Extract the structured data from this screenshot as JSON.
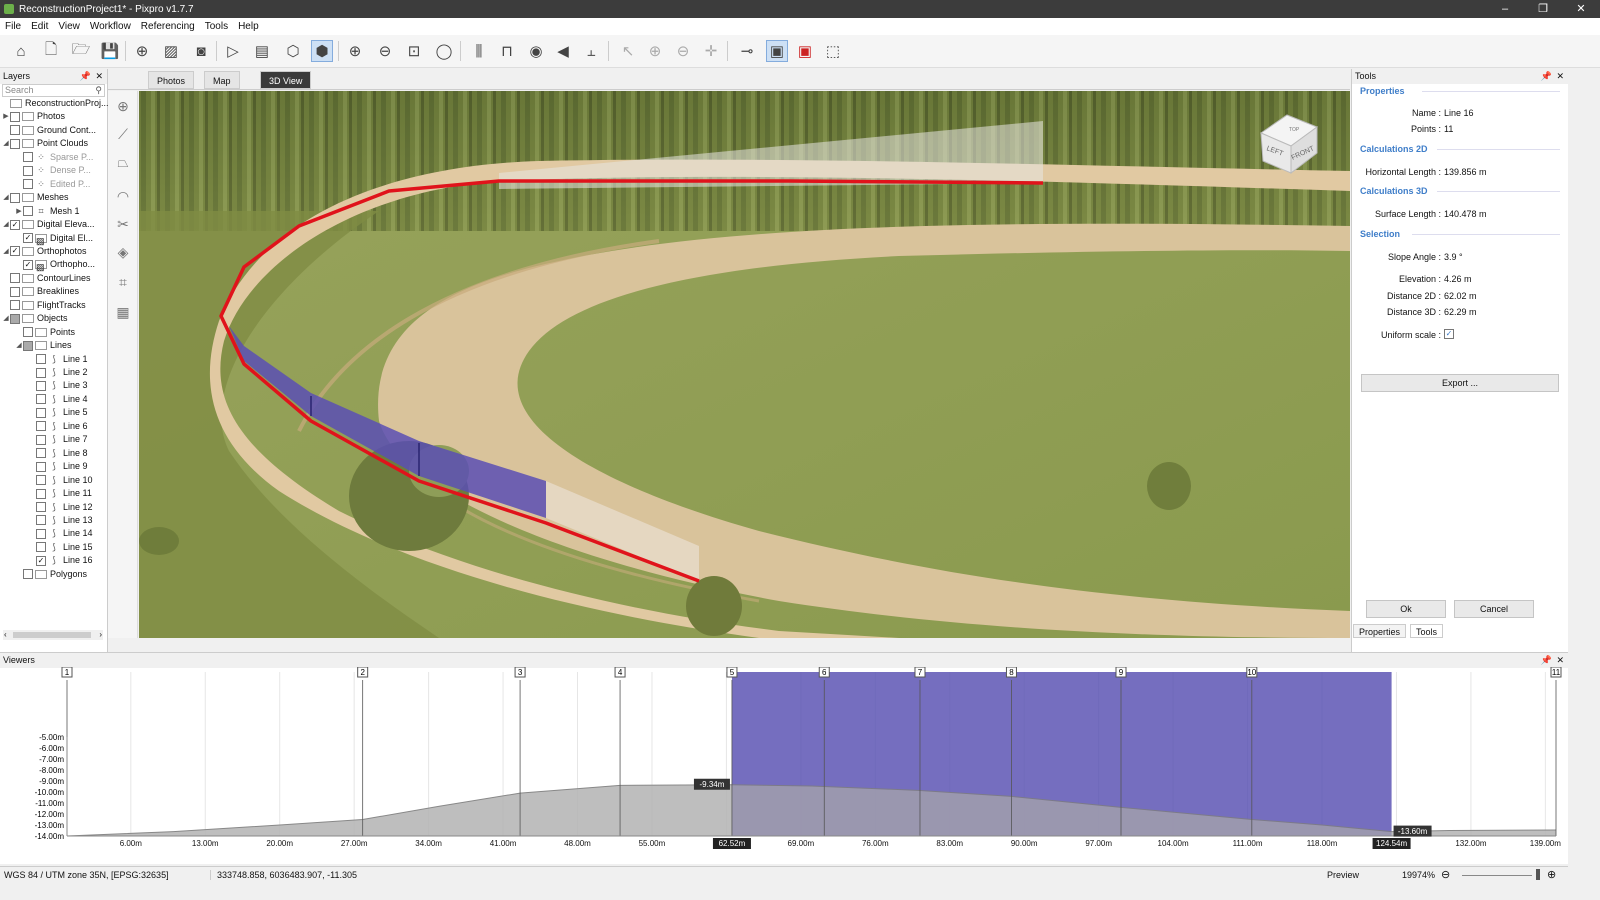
{
  "window": {
    "title": "ReconstructionProject1* - Pixpro v1.7.7",
    "controls": [
      "–",
      "❐",
      "✕"
    ]
  },
  "menu": [
    "File",
    "Edit",
    "View",
    "Workflow",
    "Referencing",
    "Tools",
    "Help"
  ],
  "toolbar": {
    "icons": [
      "home-icon",
      "new-file-icon",
      "open-folder-icon",
      "save-icon",
      "target-icon",
      "image-icon",
      "camera-icon",
      "play-icon",
      "batch-icon",
      "cube-wire-icon",
      "cube-solid-icon",
      "zoom-in-icon",
      "zoom-out-icon",
      "zoom-fit-icon",
      "zoom-window-icon",
      "align-icon",
      "measure-icon",
      "eye-icon",
      "plane-icon",
      "split-icon",
      "pointer-add-icon",
      "point-add-icon",
      "point-remove-icon",
      "point-move-icon",
      "line-point-icon",
      "view-box-icon",
      "view-box-red-icon",
      "select-rect-icon"
    ]
  },
  "layers": {
    "title": "Layers",
    "search_placeholder": "Search",
    "items": [
      {
        "label": "ReconstructionProj...",
        "level": 0,
        "twisty": "",
        "check": "none",
        "icon": "folder"
      },
      {
        "label": "Photos",
        "level": 0,
        "twisty": "▶",
        "check": "off",
        "icon": "folder"
      },
      {
        "label": "Ground Cont...",
        "level": 0,
        "twisty": "",
        "check": "off",
        "icon": "folder"
      },
      {
        "label": "Point Clouds",
        "level": 0,
        "twisty": "◢",
        "check": "off",
        "icon": "folder"
      },
      {
        "label": "Sparse P...",
        "level": 1,
        "twisty": "",
        "check": "off",
        "icon": "dots",
        "dim": true
      },
      {
        "label": "Dense P...",
        "level": 1,
        "twisty": "",
        "check": "off",
        "icon": "dots",
        "dim": true
      },
      {
        "label": "Edited P...",
        "level": 1,
        "twisty": "",
        "check": "off",
        "icon": "dots",
        "dim": true
      },
      {
        "label": "Meshes",
        "level": 0,
        "twisty": "◢",
        "check": "off",
        "icon": "folder"
      },
      {
        "label": "Mesh 1",
        "level": 1,
        "twisty": "▶",
        "check": "off",
        "icon": "mesh"
      },
      {
        "label": "Digital Eleva...",
        "level": 0,
        "twisty": "◢",
        "check": "on",
        "icon": "folder"
      },
      {
        "label": "Digital El...",
        "level": 1,
        "twisty": "",
        "check": "on",
        "icon": "image"
      },
      {
        "label": "Orthophotos",
        "level": 0,
        "twisty": "◢",
        "check": "on",
        "icon": "folder"
      },
      {
        "label": "Orthopho...",
        "level": 1,
        "twisty": "",
        "check": "on",
        "icon": "image"
      },
      {
        "label": "ContourLines",
        "level": 0,
        "twisty": "",
        "check": "off",
        "icon": "folder"
      },
      {
        "label": "Breaklines",
        "level": 0,
        "twisty": "",
        "check": "off",
        "icon": "folder"
      },
      {
        "label": "FlightTracks",
        "level": 0,
        "twisty": "",
        "check": "off",
        "icon": "folder"
      },
      {
        "label": "Objects",
        "level": 0,
        "twisty": "◢",
        "check": "partial",
        "icon": "folder"
      },
      {
        "label": "Points",
        "level": 1,
        "twisty": "",
        "check": "off",
        "icon": "folder"
      },
      {
        "label": "Lines",
        "level": 1,
        "twisty": "◢",
        "check": "partial",
        "icon": "folder"
      },
      {
        "label": "Line 1",
        "level": 2,
        "twisty": "",
        "check": "off",
        "icon": "line"
      },
      {
        "label": "Line 2",
        "level": 2,
        "twisty": "",
        "check": "off",
        "icon": "line"
      },
      {
        "label": "Line 3",
        "level": 2,
        "twisty": "",
        "check": "off",
        "icon": "line"
      },
      {
        "label": "Line 4",
        "level": 2,
        "twisty": "",
        "check": "off",
        "icon": "line"
      },
      {
        "label": "Line 5",
        "level": 2,
        "twisty": "",
        "check": "off",
        "icon": "line"
      },
      {
        "label": "Line 6",
        "level": 2,
        "twisty": "",
        "check": "off",
        "icon": "line"
      },
      {
        "label": "Line 7",
        "level": 2,
        "twisty": "",
        "check": "off",
        "icon": "line"
      },
      {
        "label": "Line 8",
        "level": 2,
        "twisty": "",
        "check": "off",
        "icon": "line"
      },
      {
        "label": "Line 9",
        "level": 2,
        "twisty": "",
        "check": "off",
        "icon": "line"
      },
      {
        "label": "Line 10",
        "level": 2,
        "twisty": "",
        "check": "off",
        "icon": "line"
      },
      {
        "label": "Line 11",
        "level": 2,
        "twisty": "",
        "check": "off",
        "icon": "line"
      },
      {
        "label": "Line 12",
        "level": 2,
        "twisty": "",
        "check": "off",
        "icon": "line"
      },
      {
        "label": "Line 13",
        "level": 2,
        "twisty": "",
        "check": "off",
        "icon": "line"
      },
      {
        "label": "Line 14",
        "level": 2,
        "twisty": "",
        "check": "off",
        "icon": "line"
      },
      {
        "label": "Line 15",
        "level": 2,
        "twisty": "",
        "check": "off",
        "icon": "line"
      },
      {
        "label": "Line 16",
        "level": 2,
        "twisty": "",
        "check": "on",
        "icon": "line"
      },
      {
        "label": "Polygons",
        "level": 1,
        "twisty": "",
        "check": "off",
        "icon": "folder"
      }
    ]
  },
  "view_tabs": [
    {
      "label": "Photos",
      "selected": false
    },
    {
      "label": "Map",
      "selected": false
    },
    {
      "label": "3D View",
      "selected": true
    }
  ],
  "viewcube": {
    "top": "TOP",
    "left": "LEFT",
    "front": "FRONT"
  },
  "tools": {
    "title": "Tools",
    "sections": {
      "properties": "Properties",
      "calc2d": "Calculations 2D",
      "calc3d": "Calculations 3D",
      "selection": "Selection"
    },
    "name_label": "Name :",
    "name_value": "Line 16",
    "points_label": "Points :",
    "points_value": "11",
    "hlen_label": "Horizontal Length :",
    "hlen_value": "139.856 m",
    "slen_label": "Surface Length :",
    "slen_value": "140.478 m",
    "slope_label": "Slope Angle :",
    "slope_value": "3.9 °",
    "elev_label": "Elevation :",
    "elev_value": "4.26 m",
    "d2_label": "Distance 2D :",
    "d2_value": "62.02 m",
    "d3_label": "Distance 3D :",
    "d3_value": "62.29 m",
    "uniform_label": "Uniform scale :",
    "uniform_checked": true,
    "export_label": "Export ...",
    "ok_label": "Ok",
    "cancel_label": "Cancel",
    "tabs": [
      "Properties",
      "Tools"
    ]
  },
  "viewers": {
    "title": "Viewers"
  },
  "chart_data": {
    "type": "area",
    "title": "",
    "xlabel": "",
    "ylabel": "",
    "x_ticks": [
      "6.00m",
      "13.00m",
      "20.00m",
      "27.00m",
      "34.00m",
      "41.00m",
      "48.00m",
      "55.00m",
      "62.52m",
      "69.00m",
      "76.00m",
      "83.00m",
      "90.00m",
      "97.00m",
      "104.00m",
      "111.00m",
      "118.00m",
      "124.54m",
      "132.00m",
      "139.00m"
    ],
    "y_ticks": [
      "-5.00m",
      "-6.00m",
      "-7.00m",
      "-8.00m",
      "-9.00m",
      "-10.00m",
      "-11.00m",
      "-12.00m",
      "-13.00m",
      "-14.00m"
    ],
    "xlim": [
      0,
      140
    ],
    "ylim": [
      -14,
      -5
    ],
    "vertex_markers": [
      {
        "label": "1",
        "x": 0
      },
      {
        "label": "2",
        "x": 27.8
      },
      {
        "label": "3",
        "x": 42.6
      },
      {
        "label": "4",
        "x": 52.0
      },
      {
        "label": "5",
        "x": 62.52
      },
      {
        "label": "6",
        "x": 71.2
      },
      {
        "label": "7",
        "x": 80.2
      },
      {
        "label": "8",
        "x": 88.8
      },
      {
        "label": "9",
        "x": 99.1
      },
      {
        "label": "10",
        "x": 111.4
      },
      {
        "label": "11",
        "x": 140
      }
    ],
    "selection_range": [
      62.52,
      124.54
    ],
    "selection_labels": {
      "start_x": "62.52m",
      "end_x": "124.54m",
      "start_y": "-9.34m",
      "end_y": "-13.60m"
    },
    "profile": {
      "x": [
        0,
        10,
        20,
        27.8,
        35,
        42.6,
        52,
        62.52,
        70,
        80,
        88.8,
        99.1,
        111.4,
        118,
        124.54,
        130,
        140
      ],
      "y": [
        -14.0,
        -13.6,
        -13.0,
        -12.5,
        -11.3,
        -10.1,
        -9.4,
        -9.34,
        -9.45,
        -9.85,
        -10.4,
        -11.4,
        -12.5,
        -13.0,
        -13.6,
        -13.5,
        -13.45
      ]
    },
    "colors": {
      "selection": "#5b54b8",
      "profile_fill": "#b3b3b3",
      "line": "#888888"
    }
  },
  "statusbar": {
    "crs": "WGS 84 / UTM zone 35N, [EPSG:32635]",
    "coords": "333748.858, 6036483.907, -11.305",
    "mode": "Preview",
    "zoom": "19974%"
  }
}
